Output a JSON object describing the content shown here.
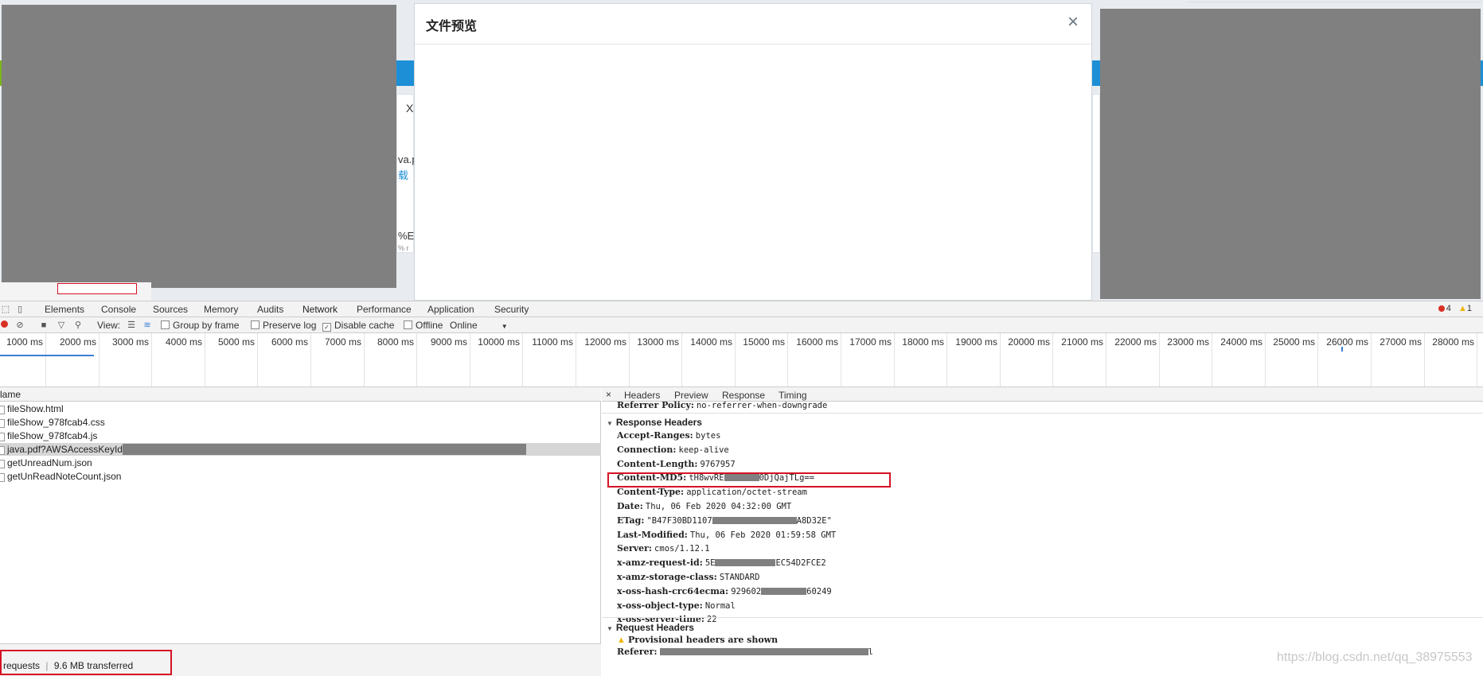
{
  "page_fragments": {
    "x_char": "X",
    "frag_va": "va.p",
    "frag_dl": "载",
    "frag_pct": "%E",
    "frag_small": "% r"
  },
  "modal": {
    "title": "文件预览",
    "close_glyph": "×"
  },
  "devtools": {
    "tabs": [
      "Elements",
      "Console",
      "Sources",
      "Memory",
      "Audits",
      "Network",
      "Performance",
      "Application",
      "Security"
    ],
    "error_count": "4",
    "warning_count": "1",
    "toolbar": {
      "view_label": "View:",
      "group_by_frame": "Group by frame",
      "preserve_log": "Preserve log",
      "disable_cache": "Disable cache",
      "offline": "Offline",
      "throttle": "Online"
    },
    "timeline_ticks": [
      "1000 ms",
      "2000 ms",
      "3000 ms",
      "4000 ms",
      "5000 ms",
      "6000 ms",
      "7000 ms",
      "8000 ms",
      "9000 ms",
      "10000 ms",
      "11000 ms",
      "12000 ms",
      "13000 ms",
      "14000 ms",
      "15000 ms",
      "16000 ms",
      "17000 ms",
      "18000 ms",
      "19000 ms",
      "20000 ms",
      "21000 ms",
      "22000 ms",
      "23000 ms",
      "24000 ms",
      "25000 ms",
      "26000 ms",
      "27000 ms",
      "28000 ms"
    ],
    "name_header": "lame",
    "requests": [
      {
        "name": "fileShow.html",
        "selected": false
      },
      {
        "name": "fileShow_978fcab4.css",
        "selected": false
      },
      {
        "name": "fileShow_978fcab4.js",
        "selected": false
      },
      {
        "name": "java.pdf?AWSAccessKeyId=",
        "selected": true
      },
      {
        "name": "getUnreadNum.json",
        "selected": false
      },
      {
        "name": "getUnReadNoteCount.json",
        "selected": false
      }
    ],
    "status": {
      "requests": "requests",
      "separator": "|",
      "transferred": "9.6 MB transferred"
    },
    "detail_tabs": [
      "×",
      "Headers",
      "Preview",
      "Response",
      "Timing"
    ],
    "referrer_policy": {
      "key": "Referrer Policy:",
      "value": "no-referrer-when-downgrade"
    },
    "response_headers_title": "Response Headers",
    "response_headers": [
      {
        "key": "Accept-Ranges:",
        "value": "bytes"
      },
      {
        "key": "Connection:",
        "value": "keep-alive"
      },
      {
        "key": "Content-Length:",
        "value": "9767957"
      },
      {
        "key": "Content-MD5:",
        "value": "tH8wvRE",
        "value_end": "0DjQajTLg=="
      },
      {
        "key": "Content-Type:",
        "value": "application/octet-stream"
      },
      {
        "key": "Date:",
        "value": "Thu, 06 Feb 2020 04:32:00 GMT"
      },
      {
        "key": "ETag:",
        "value": "\"B47F30BD1107",
        "value_end": "A8D32E\""
      },
      {
        "key": "Last-Modified:",
        "value": "Thu, 06 Feb 2020 01:59:58 GMT"
      },
      {
        "key": "Server:",
        "value": "cmos/1.12.1"
      },
      {
        "key": "x-amz-request-id:",
        "value": "5E",
        "value_end": "EC54D2FCE2"
      },
      {
        "key": "x-amz-storage-class:",
        "value": "STANDARD"
      },
      {
        "key": "x-oss-hash-crc64ecma:",
        "value": "929602",
        "value_end": "60249"
      },
      {
        "key": "x-oss-object-type:",
        "value": "Normal"
      },
      {
        "key": "x-oss-server-time:",
        "value": "22"
      }
    ],
    "request_headers_title": "Request Headers",
    "provisional_warning": "Provisional headers are shown",
    "referer_key": "Referer:",
    "referer_tail": "l"
  },
  "watermark": "https://blog.csdn.net/qq_38975553",
  "colors": {
    "highlight_box": "#d51224",
    "accent_blue": "#1d8fd6",
    "redaction": "#808080"
  }
}
